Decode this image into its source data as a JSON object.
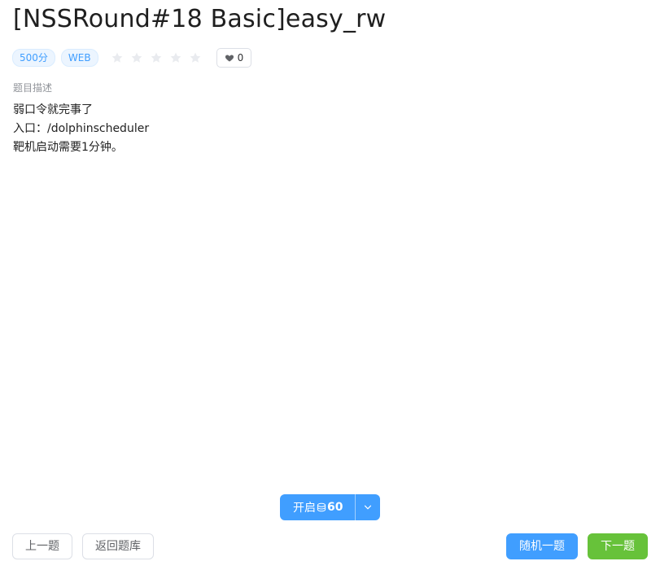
{
  "challenge": {
    "title": "[NSSRound#18 Basic]easy_rw",
    "points_tag": "500分",
    "category_tag": "WEB",
    "rating": 0,
    "rating_max": 5,
    "likes": "0"
  },
  "description": {
    "label": "题目描述",
    "lines": [
      "弱口令就完事了",
      "入口：/dolphinscheduler",
      "靶机启动需要1分钟。"
    ]
  },
  "actions": {
    "start_label": "开启",
    "start_cost": "60",
    "prev_label": "上一题",
    "back_label": "返回题库",
    "random_label": "随机一题",
    "next_label": "下一题"
  },
  "colors": {
    "primary": "#409eff",
    "success": "#67c23a",
    "star_empty": "#e9ebef"
  },
  "icons": {
    "like": "heart-icon",
    "rating": "star-icon",
    "coin": "coin-icon",
    "dropdown": "chevron-down-icon"
  }
}
